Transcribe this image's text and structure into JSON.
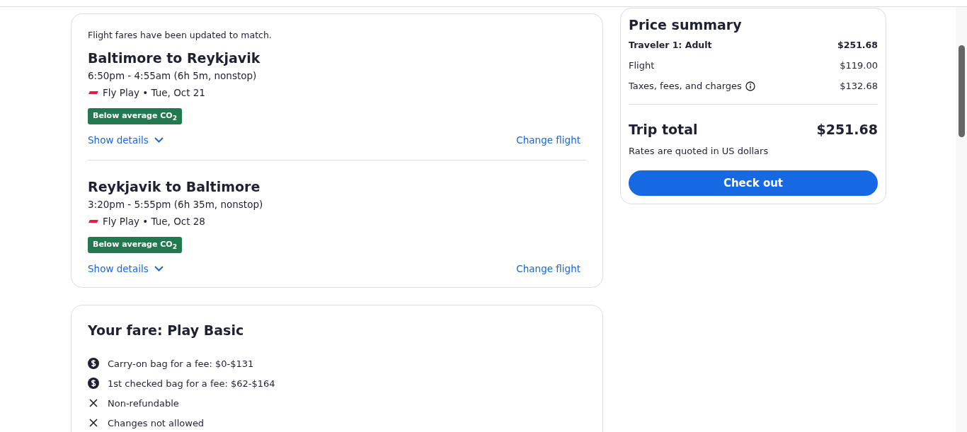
{
  "notice": "Flight fares have been updated to match.",
  "flights": [
    {
      "route": "Baltimore to Reykjavik",
      "times": "6:50pm - 4:55am (6h 5m, nonstop)",
      "airline": "Fly Play • Tue, Oct 21",
      "badge": "Below average CO$_{2}$",
      "details_link": "Show details",
      "change_link": "Change flight"
    },
    {
      "route": "Reykjavik to Baltimore",
      "times": "3:20pm - 5:55pm (6h 35m, nonstop)",
      "airline": "Fly Play • Tue, Oct 28",
      "badge": "Below average CO$_{2}$",
      "details_link": "Show details",
      "change_link": "Change flight"
    }
  ],
  "fare": {
    "title": "Your fare: Play Basic",
    "items": [
      {
        "kind": "fee",
        "text": "Carry-on bag for a fee: $0-$131"
      },
      {
        "kind": "fee",
        "text": "1st checked bag for a fee: $62-$164"
      },
      {
        "kind": "excluded",
        "text": "Non-refundable"
      },
      {
        "kind": "excluded",
        "text": "Changes not allowed"
      }
    ]
  },
  "price_summary": {
    "title": "Price summary",
    "traveler": {
      "label": "Traveler 1: Adult",
      "amount": "$251.68"
    },
    "lines": [
      {
        "label": "Flight",
        "amount": "$119.00",
        "info": false
      },
      {
        "label": "Taxes, fees, and charges",
        "amount": "$132.68",
        "info": true
      }
    ],
    "total_label": "Trip total",
    "total": "$251.68",
    "note": "Rates are quoted in US dollars",
    "button": "Check out"
  }
}
